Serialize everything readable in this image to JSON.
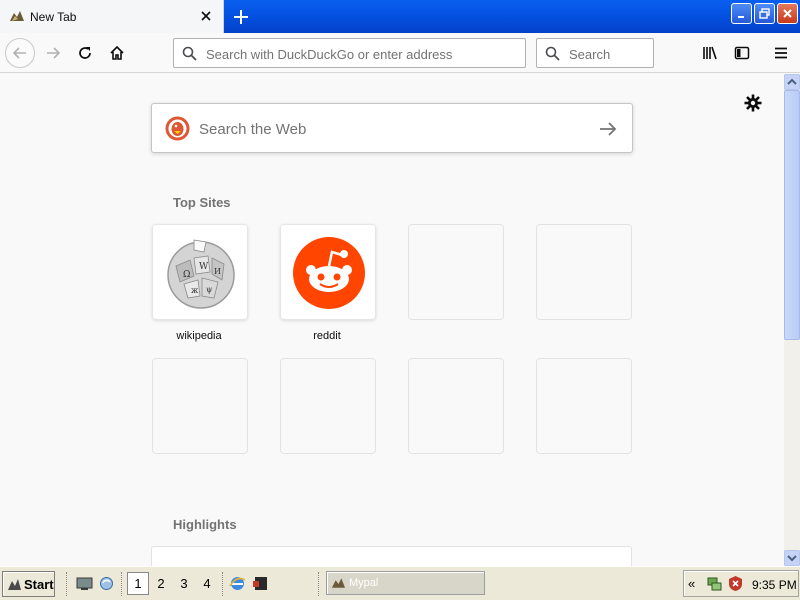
{
  "browser": {
    "tab_title": "New Tab",
    "url_placeholder": "Search with DuckDuckGo or enter address",
    "search_placeholder": "Search"
  },
  "newtab": {
    "web_search_placeholder": "Search the Web",
    "top_sites_title": "Top Sites",
    "top_sites": [
      {
        "label": "wikipedia",
        "icon": "wikipedia-globe-icon"
      },
      {
        "label": "reddit",
        "icon": "reddit-alien-icon"
      }
    ],
    "highlights_title": "Highlights"
  },
  "taskbar": {
    "start_label": "Start",
    "workspaces": [
      "1",
      "2",
      "3",
      "4"
    ],
    "active_workspace": "1",
    "task_label": "Mypal",
    "clock": "9:35 PM"
  },
  "colors": {
    "titlebar_blue": "#0450e0",
    "reddit_orange": "#ff4500",
    "ddg_orange": "#de5833"
  }
}
